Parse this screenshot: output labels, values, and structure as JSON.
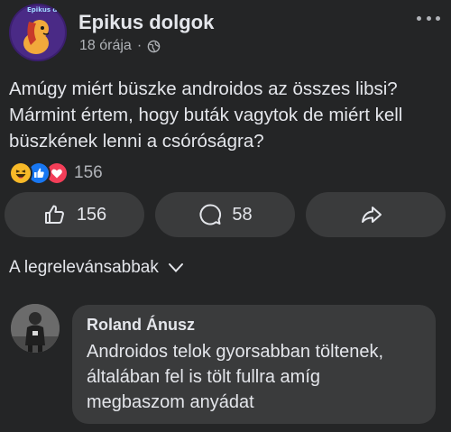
{
  "post": {
    "page_name": "Epikus dolgok",
    "timestamp": "18 órája",
    "separator": "·",
    "privacy_icon": "globe-icon",
    "avatar_text": "Epikus dolgok",
    "body_lines": [
      "Amúgy miért büszke androidos az összes libsi?",
      "Mármint értem, hogy buták vagytok de miért kell",
      "büszkének lenni a csóróságra?"
    ]
  },
  "reactions": {
    "icons": [
      "haha-icon",
      "like-icon",
      "love-icon"
    ],
    "count": "156"
  },
  "actions": {
    "like_count": "156",
    "comment_count": "58",
    "share_label": ""
  },
  "sort": {
    "label": "A legrelevánsabbak"
  },
  "comment": {
    "author": "Roland Ánusz",
    "lines": [
      "Androidos telok gyorsabban töltenek,",
      "általában fel is tölt fullra amíg",
      "megbaszom anyádat"
    ]
  },
  "colors": {
    "background": "#242526",
    "surface": "#3a3b3c",
    "text": "#e4e6eb",
    "secondary_text": "#b0b3b8",
    "like_blue": "#1877f2",
    "love_red": "#f33e58",
    "haha_yellow": "#f7b928"
  }
}
